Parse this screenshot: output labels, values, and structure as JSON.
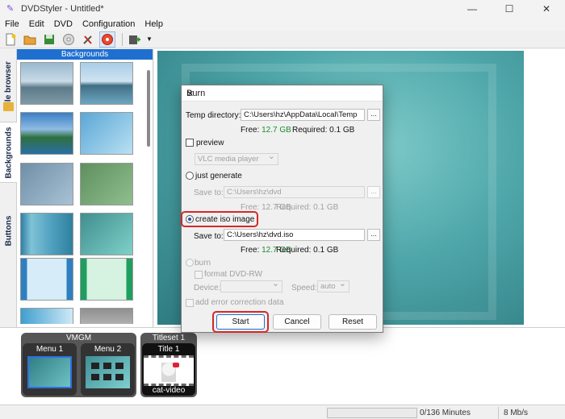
{
  "window": {
    "title": "DVDStyler - Untitled*",
    "minimize": "—",
    "maximize": "☐",
    "close": "✕"
  },
  "menu": [
    "File",
    "Edit",
    "DVD",
    "Configuration",
    "Help"
  ],
  "side_tabs": {
    "file_browser": "File browser",
    "backgrounds": "Backgrounds",
    "buttons": "Buttons"
  },
  "panel": {
    "header": "Backgrounds"
  },
  "bottom": {
    "vmgm": {
      "title": "VMGM",
      "menus": [
        "Menu 1",
        "Menu 2"
      ]
    },
    "titleset": {
      "title": "Titleset 1",
      "title_label": "Title 1",
      "video_name": "cat-video"
    }
  },
  "status": {
    "minutes": "0/136 Minutes",
    "rate": "8 Mb/s"
  },
  "dialog": {
    "title": "Burn",
    "temp_label": "Temp directory:",
    "temp_value": "C:\\Users\\hz\\AppData\\Local\\Temp",
    "browse": "...",
    "free_label": "Free:",
    "free_value": "12.7 GB",
    "required_label": "Required: 0.1 GB",
    "preview_label": "preview",
    "preview_player": "VLC media player",
    "just_generate_label": "just generate",
    "save_to_label": "Save to:",
    "gen_save_value": "C:\\Users\\hz\\dvd",
    "iso_label": "create iso image",
    "iso_save_value": "C:\\Users\\hz\\dvd.iso",
    "burn_label": "burn",
    "format_label": "format DVD-RW",
    "device_label": "Device:",
    "speed_label": "Speed:",
    "speed_value": "auto",
    "ecc_label": "add error correction data",
    "start": "Start",
    "cancel": "Cancel",
    "reset": "Reset"
  },
  "colors": {
    "accent": "#1f6fd1",
    "highlight": "#d62828",
    "free_space": "#1e8a2e"
  }
}
